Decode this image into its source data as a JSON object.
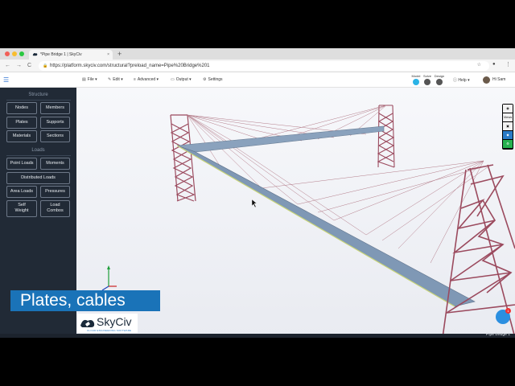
{
  "browser": {
    "tab_title": "*Pipe Bridge 1 | SkyCiv",
    "tab_close": "×",
    "new_tab": "+",
    "url": "https://platform.skyciv.com/structural?preload_name=Pipe%20Bridge%201",
    "nav": {
      "back": "←",
      "forward": "→",
      "reload": "C"
    }
  },
  "toolbar": {
    "file": "File",
    "edit": "Edit",
    "advanced": "Advanced",
    "output": "Output",
    "settings": "Settings",
    "modes": [
      {
        "label": "Model",
        "active": true
      },
      {
        "label": "Solve",
        "active": false
      },
      {
        "label": "Design",
        "active": false
      }
    ],
    "help": "Help",
    "user": "Hi Sam"
  },
  "sidebar": {
    "structure_title": "Structure",
    "structure_buttons": [
      "Nodes",
      "Members",
      "Plates",
      "Supports",
      "Materials",
      "Sections"
    ],
    "loads_title": "Loads",
    "point_loads": "Point Loads",
    "moments": "Moments",
    "distributed_loads": "Distributed Loads",
    "area_loads": "Area Loads",
    "pressures": "Pressures",
    "self_weight_1": "Self",
    "self_weight_2": "Weight",
    "load_combos_1": "Load",
    "load_combos_2": "Combos"
  },
  "view_tools": [
    "eye-icon",
    "Views",
    "camera-icon",
    "layers-icon",
    "settings-icon"
  ],
  "view_label": "Views",
  "caption": "Plates, cables",
  "brand": {
    "name": "SkyCiv",
    "tagline": "CLOUD ENGINEERING SOFTWARE"
  },
  "status": "Pipe Bridge 1*",
  "chat_badge": "1",
  "colors": {
    "accent": "#1a73b8",
    "sidebar_bg": "#212a36",
    "truss": "#9b4a5e",
    "deck": "#7f98b5",
    "cable": "#a86a7a"
  }
}
